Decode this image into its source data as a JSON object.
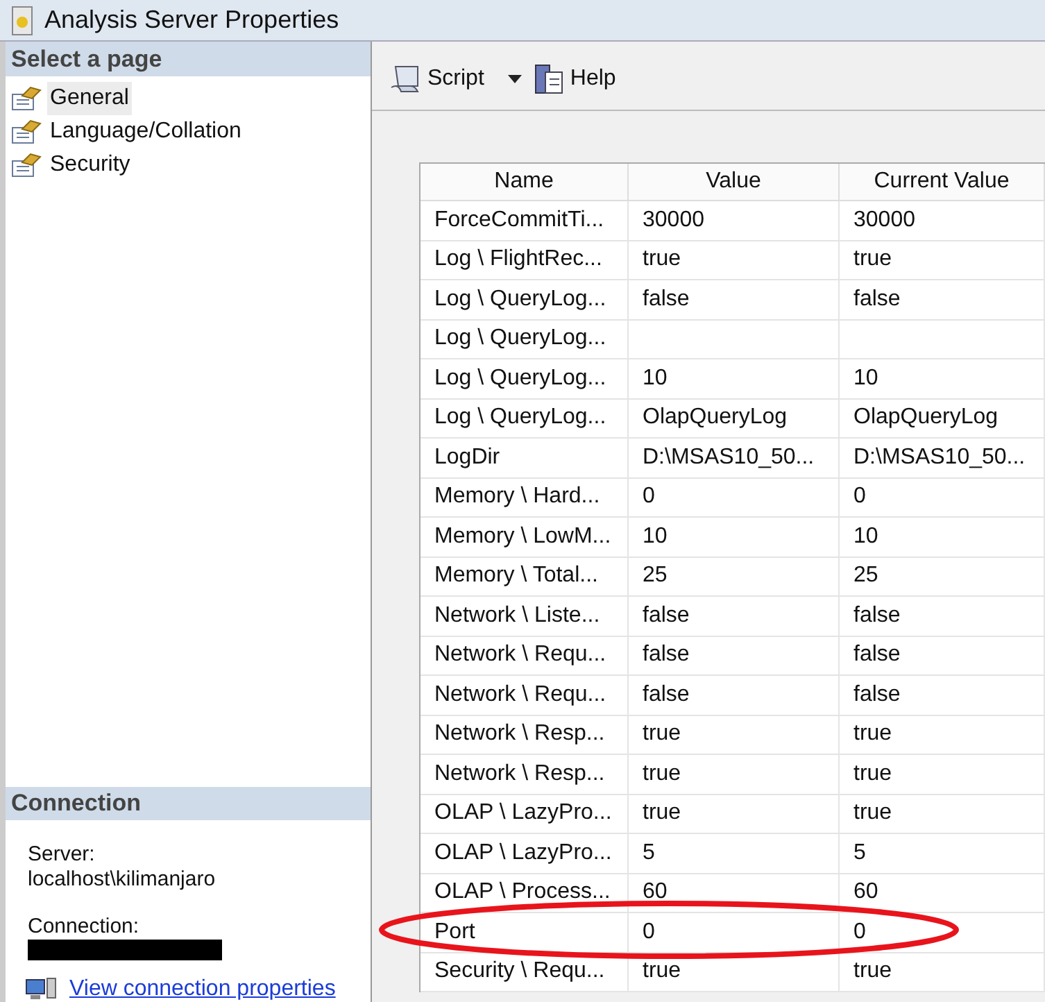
{
  "window": {
    "title": "Analysis Server Properties"
  },
  "sidebar": {
    "header": "Select a page",
    "items": [
      {
        "label": "General",
        "selected": true
      },
      {
        "label": "Language/Collation",
        "selected": false
      },
      {
        "label": "Security",
        "selected": false
      }
    ]
  },
  "connection": {
    "header": "Connection",
    "server_label": "Server:",
    "server": "localhost\\kilimanjaro",
    "connection_label": "Connection:",
    "link": "View connection properties"
  },
  "toolbar": {
    "script": "Script",
    "help": "Help"
  },
  "table": {
    "columns": [
      "Name",
      "Value",
      "Current Value"
    ],
    "rows": [
      [
        "ForceCommitTi...",
        "30000",
        "30000"
      ],
      [
        "Log \\ FlightRec...",
        "true",
        "true"
      ],
      [
        "Log \\ QueryLog...",
        "false",
        "false"
      ],
      [
        "Log \\ QueryLog...",
        "",
        ""
      ],
      [
        "Log \\ QueryLog...",
        "10",
        "10"
      ],
      [
        "Log \\ QueryLog...",
        "OlapQueryLog",
        "OlapQueryLog"
      ],
      [
        "LogDir",
        "D:\\MSAS10_50...",
        "D:\\MSAS10_50..."
      ],
      [
        "Memory \\ Hard...",
        "0",
        "0"
      ],
      [
        "Memory \\ LowM...",
        "10",
        "10"
      ],
      [
        "Memory \\ Total...",
        "25",
        "25"
      ],
      [
        "Network \\ Liste...",
        "false",
        "false"
      ],
      [
        "Network \\ Requ...",
        "false",
        "false"
      ],
      [
        "Network \\ Requ...",
        "false",
        "false"
      ],
      [
        "Network \\ Resp...",
        "true",
        "true"
      ],
      [
        "Network \\ Resp...",
        "true",
        "true"
      ],
      [
        "OLAP \\ LazyPro...",
        "true",
        "true"
      ],
      [
        "OLAP \\ LazyPro...",
        "5",
        "5"
      ],
      [
        "OLAP \\ Process...",
        "60",
        "60"
      ],
      [
        "Port",
        "0",
        "0"
      ],
      [
        "Security \\ Requ...",
        "true",
        "true"
      ]
    ]
  }
}
